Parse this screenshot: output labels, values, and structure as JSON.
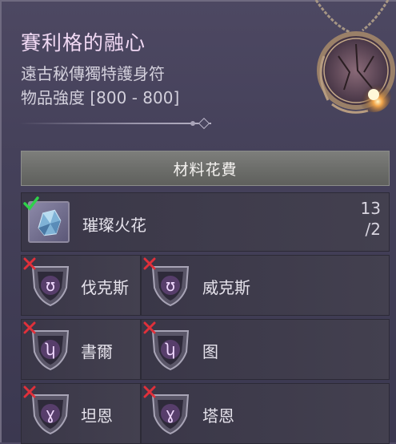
{
  "item": {
    "name": "賽利格的融心",
    "type": "遠古秘傳獨特護身符",
    "strength": "物品強度 [800 - 800]"
  },
  "materials_header": "材料花費",
  "main_material": {
    "name": "璀璨火花",
    "have": "13",
    "need": "/2",
    "satisfied": true
  },
  "runes": [
    {
      "name": "伐克斯",
      "glyph": "ʊ",
      "satisfied": false
    },
    {
      "name": "威克斯",
      "glyph": "ʊ",
      "satisfied": false
    },
    {
      "name": "書爾",
      "glyph": "ʮ",
      "satisfied": false
    },
    {
      "name": "图",
      "glyph": "ʮ",
      "satisfied": false
    },
    {
      "name": "坦恩",
      "glyph": "ɣ",
      "satisfied": false
    },
    {
      "name": "塔恩",
      "glyph": "ɣ",
      "satisfied": false
    }
  ],
  "colors": {
    "title": "#f1d9f4",
    "check": "#2fd14a",
    "xmark": "#e0303a",
    "rune_glow": "#d27cff"
  }
}
